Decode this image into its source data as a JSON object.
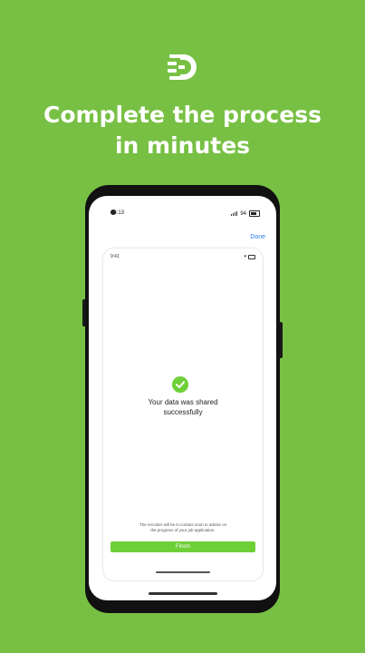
{
  "headline": {
    "line1": "Complete the process",
    "line2": "in minutes"
  },
  "colors": {
    "background": "#77c043",
    "accent_green": "#6fcf38",
    "link_blue": "#2b7be8"
  },
  "phone": {
    "status": {
      "time": "16:13",
      "battery": "94"
    },
    "done_label": "Done",
    "sheet": {
      "status_time": "9:41",
      "success_line1": "Your data was shared",
      "success_line2": "successfully",
      "note_line1": "The recruiter will be in contact soon to advise on",
      "note_line2": "the progress of your job application.",
      "finish_label": "Finish"
    }
  }
}
